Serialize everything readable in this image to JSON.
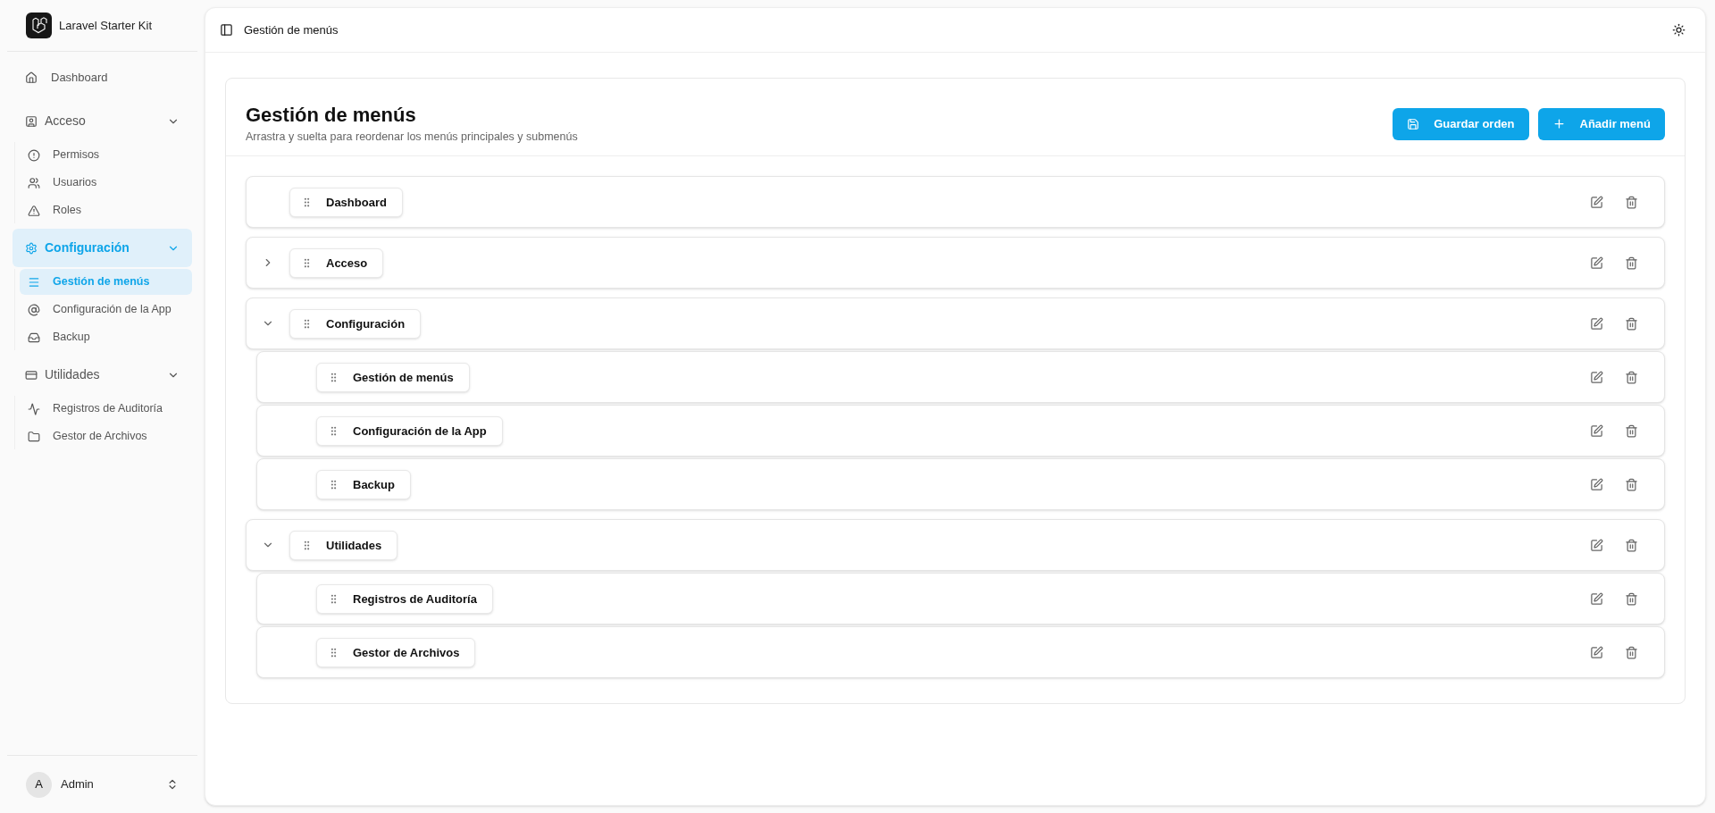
{
  "sidebar": {
    "app_name": "Laravel Starter Kit",
    "nav": [
      {
        "kind": "link",
        "label": "Dashboard",
        "selected": false
      },
      {
        "kind": "group",
        "label": "Acceso",
        "selected": false,
        "expanded": true,
        "children": [
          {
            "label": "Permisos",
            "selected": false
          },
          {
            "label": "Usuarios",
            "selected": false
          },
          {
            "label": "Roles",
            "selected": false
          }
        ]
      },
      {
        "kind": "group",
        "label": "Configuración",
        "selected": true,
        "expanded": true,
        "children": [
          {
            "label": "Gestión de menús",
            "selected": true
          },
          {
            "label": "Configuración de la App",
            "selected": false
          },
          {
            "label": "Backup",
            "selected": false
          }
        ]
      },
      {
        "kind": "group",
        "label": "Utilidades",
        "selected": false,
        "expanded": true,
        "children": [
          {
            "label": "Registros de Auditoría",
            "selected": false
          },
          {
            "label": "Gestor de Archivos",
            "selected": false
          }
        ]
      }
    ],
    "user": {
      "initial": "A",
      "name": "Admin"
    }
  },
  "header": {
    "breadcrumb": "Gestión de menús"
  },
  "card": {
    "title": "Gestión de menús",
    "subtitle": "Arrastra y suelta para reordenar los menús principales y submenús",
    "buttons": [
      {
        "kind": "save",
        "label": "Guardar orden"
      },
      {
        "kind": "add",
        "label": "Añadir menú"
      }
    ],
    "menu_tree": [
      {
        "label": "Dashboard",
        "has_children": false
      },
      {
        "label": "Acceso",
        "has_children": true,
        "expanded": false
      },
      {
        "label": "Configuración",
        "has_children": true,
        "expanded": true,
        "children": [
          {
            "label": "Gestión de menús"
          },
          {
            "label": "Configuración de la App"
          },
          {
            "label": "Backup"
          }
        ]
      },
      {
        "label": "Utilidades",
        "has_children": true,
        "expanded": true,
        "children": [
          {
            "label": "Registros de Auditoría"
          },
          {
            "label": "Gestor de Archivos"
          }
        ]
      }
    ]
  }
}
